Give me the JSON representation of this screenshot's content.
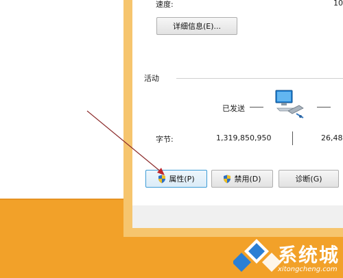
{
  "general": {
    "speed_label": "速度:",
    "speed_value": "10",
    "details_button": "详细信息(E)..."
  },
  "activity": {
    "section_label": "活动",
    "sent_label": "已发送",
    "bytes_label": "字节:",
    "bytes_sent": "1,319,850,950",
    "bytes_received": "26,48"
  },
  "buttons": {
    "properties": "属性(P)",
    "disable": "禁用(D)",
    "diagnose": "诊断(G)"
  },
  "watermark": {
    "brand": "系统城",
    "url": "xitongcheng.com"
  },
  "colors": {
    "desktop_orange": "#f2a129",
    "window_border": "#f6c56e",
    "focus_blue": "#3c9bd6",
    "arrow": "#8b2a2a"
  }
}
